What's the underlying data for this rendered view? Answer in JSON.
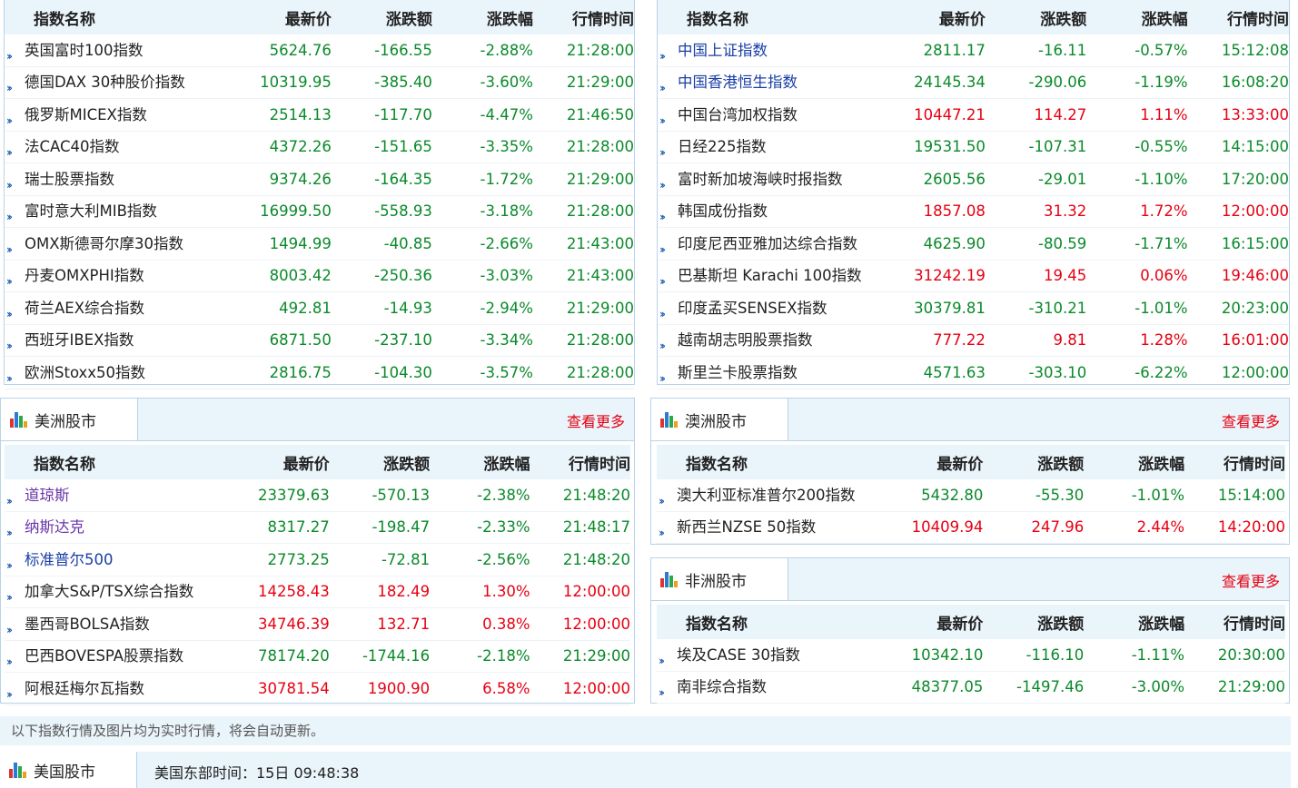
{
  "panels": {
    "europe": {
      "headers": [
        "指数名称",
        "最新价",
        "涨跌额",
        "涨跌幅",
        "行情时间"
      ],
      "rows": [
        {
          "name": "英国富时100指数",
          "price": "5624.76",
          "change": "-166.55",
          "pct": "-2.88%",
          "time": "21:28:00",
          "dir": "green",
          "nameColor": "black"
        },
        {
          "name": "德国DAX 30种股价指数",
          "price": "10319.95",
          "change": "-385.40",
          "pct": "-3.60%",
          "time": "21:29:00",
          "dir": "green",
          "nameColor": "black"
        },
        {
          "name": "俄罗斯MICEX指数",
          "price": "2514.13",
          "change": "-117.70",
          "pct": "-4.47%",
          "time": "21:46:50",
          "dir": "green",
          "nameColor": "black"
        },
        {
          "name": "法CAC40指数",
          "price": "4372.26",
          "change": "-151.65",
          "pct": "-3.35%",
          "time": "21:28:00",
          "dir": "green",
          "nameColor": "black"
        },
        {
          "name": "瑞士股票指数",
          "price": "9374.26",
          "change": "-164.35",
          "pct": "-1.72%",
          "time": "21:29:00",
          "dir": "green",
          "nameColor": "black"
        },
        {
          "name": "富时意大利MIB指数",
          "price": "16999.50",
          "change": "-558.93",
          "pct": "-3.18%",
          "time": "21:28:00",
          "dir": "green",
          "nameColor": "black"
        },
        {
          "name": "OMX斯德哥尔摩30指数",
          "price": "1494.99",
          "change": "-40.85",
          "pct": "-2.66%",
          "time": "21:43:00",
          "dir": "green",
          "nameColor": "black"
        },
        {
          "name": "丹麦OMXPHI指数",
          "price": "8003.42",
          "change": "-250.36",
          "pct": "-3.03%",
          "time": "21:43:00",
          "dir": "green",
          "nameColor": "black"
        },
        {
          "name": "荷兰AEX综合指数",
          "price": "492.81",
          "change": "-14.93",
          "pct": "-2.94%",
          "time": "21:29:00",
          "dir": "green",
          "nameColor": "black"
        },
        {
          "name": "西班牙IBEX指数",
          "price": "6871.50",
          "change": "-237.10",
          "pct": "-3.34%",
          "time": "21:28:00",
          "dir": "green",
          "nameColor": "black"
        },
        {
          "name": "欧洲Stoxx50指数",
          "price": "2816.75",
          "change": "-104.30",
          "pct": "-3.57%",
          "time": "21:28:00",
          "dir": "green",
          "nameColor": "black"
        }
      ]
    },
    "asia": {
      "headers": [
        "指数名称",
        "最新价",
        "涨跌额",
        "涨跌幅",
        "行情时间"
      ],
      "rows": [
        {
          "name": "中国上证指数",
          "price": "2811.17",
          "change": "-16.11",
          "pct": "-0.57%",
          "time": "15:12:08",
          "dir": "green",
          "nameColor": "link"
        },
        {
          "name": "中国香港恒生指数",
          "price": "24145.34",
          "change": "-290.06",
          "pct": "-1.19%",
          "time": "16:08:20",
          "dir": "green",
          "nameColor": "link"
        },
        {
          "name": "中国台湾加权指数",
          "price": "10447.21",
          "change": "114.27",
          "pct": "1.11%",
          "time": "13:33:00",
          "dir": "red",
          "nameColor": "black"
        },
        {
          "name": "日经225指数",
          "price": "19531.50",
          "change": "-107.31",
          "pct": "-0.55%",
          "time": "14:15:00",
          "dir": "green",
          "nameColor": "black"
        },
        {
          "name": "富时新加坡海峡时报指数",
          "price": "2605.56",
          "change": "-29.01",
          "pct": "-1.10%",
          "time": "17:20:00",
          "dir": "green",
          "nameColor": "black"
        },
        {
          "name": "韩国成份指数",
          "price": "1857.08",
          "change": "31.32",
          "pct": "1.72%",
          "time": "12:00:00",
          "dir": "red",
          "nameColor": "black"
        },
        {
          "name": "印度尼西亚雅加达综合指数",
          "price": "4625.90",
          "change": "-80.59",
          "pct": "-1.71%",
          "time": "16:15:00",
          "dir": "green",
          "nameColor": "black"
        },
        {
          "name": "巴基斯坦 Karachi 100指数",
          "price": "31242.19",
          "change": "19.45",
          "pct": "0.06%",
          "time": "19:46:00",
          "dir": "red",
          "nameColor": "black"
        },
        {
          "name": "印度孟买SENSEX指数",
          "price": "30379.81",
          "change": "-310.21",
          "pct": "-1.01%",
          "time": "20:23:00",
          "dir": "green",
          "nameColor": "black"
        },
        {
          "name": "越南胡志明股票指数",
          "price": "777.22",
          "change": "9.81",
          "pct": "1.28%",
          "time": "16:01:00",
          "dir": "red",
          "nameColor": "black"
        },
        {
          "name": "斯里兰卡股票指数",
          "price": "4571.63",
          "change": "-303.10",
          "pct": "-6.22%",
          "time": "12:00:00",
          "dir": "green",
          "nameColor": "black"
        }
      ]
    },
    "americas": {
      "title": "美洲股市",
      "more": "查看更多",
      "headers": [
        "指数名称",
        "最新价",
        "涨跌额",
        "涨跌幅",
        "行情时间"
      ],
      "rows": [
        {
          "name": "道琼斯",
          "price": "23379.63",
          "change": "-570.13",
          "pct": "-2.38%",
          "time": "21:48:20",
          "dir": "green",
          "nameColor": "purple"
        },
        {
          "name": "纳斯达克",
          "price": "8317.27",
          "change": "-198.47",
          "pct": "-2.33%",
          "time": "21:48:17",
          "dir": "green",
          "nameColor": "purple"
        },
        {
          "name": "标准普尔500",
          "price": "2773.25",
          "change": "-72.81",
          "pct": "-2.56%",
          "time": "21:48:20",
          "dir": "green",
          "nameColor": "link"
        },
        {
          "name": "加拿大S&P/TSX综合指数",
          "price": "14258.43",
          "change": "182.49",
          "pct": "1.30%",
          "time": "12:00:00",
          "dir": "red",
          "nameColor": "black"
        },
        {
          "name": "墨西哥BOLSA指数",
          "price": "34746.39",
          "change": "132.71",
          "pct": "0.38%",
          "time": "12:00:00",
          "dir": "red",
          "nameColor": "black"
        },
        {
          "name": "巴西BOVESPA股票指数",
          "price": "78174.20",
          "change": "-1744.16",
          "pct": "-2.18%",
          "time": "21:29:00",
          "dir": "green",
          "nameColor": "black"
        },
        {
          "name": "阿根廷梅尔瓦指数",
          "price": "30781.54",
          "change": "1900.90",
          "pct": "6.58%",
          "time": "12:00:00",
          "dir": "red",
          "nameColor": "black"
        }
      ]
    },
    "oceania": {
      "title": "澳洲股市",
      "more": "查看更多",
      "headers": [
        "指数名称",
        "最新价",
        "涨跌额",
        "涨跌幅",
        "行情时间"
      ],
      "rows": [
        {
          "name": "澳大利亚标准普尔200指数",
          "price": "5432.80",
          "change": "-55.30",
          "pct": "-1.01%",
          "time": "15:14:00",
          "dir": "green",
          "nameColor": "black"
        },
        {
          "name": "新西兰NZSE 50指数",
          "price": "10409.94",
          "change": "247.96",
          "pct": "2.44%",
          "time": "14:20:00",
          "dir": "red",
          "nameColor": "black"
        }
      ]
    },
    "africa": {
      "title": "非洲股市",
      "more": "查看更多",
      "headers": [
        "指数名称",
        "最新价",
        "涨跌额",
        "涨跌幅",
        "行情时间"
      ],
      "rows": [
        {
          "name": "埃及CASE 30指数",
          "price": "10342.10",
          "change": "-116.10",
          "pct": "-1.11%",
          "time": "20:30:00",
          "dir": "green",
          "nameColor": "black"
        },
        {
          "name": "南非综合指数",
          "price": "48377.05",
          "change": "-1497.46",
          "pct": "-3.00%",
          "time": "21:29:00",
          "dir": "green",
          "nameColor": "black"
        }
      ]
    }
  },
  "notice": "以下指数行情及图片均为实时行情，将会自动更新。",
  "us_market": {
    "title": "美国股市",
    "time_label": "美国东部时间：15日 09:48:38"
  },
  "colors": {
    "up": "#e60012",
    "down": "#0a8a2a",
    "link": "#1a3fa5",
    "accent": "#eaf4fb"
  }
}
